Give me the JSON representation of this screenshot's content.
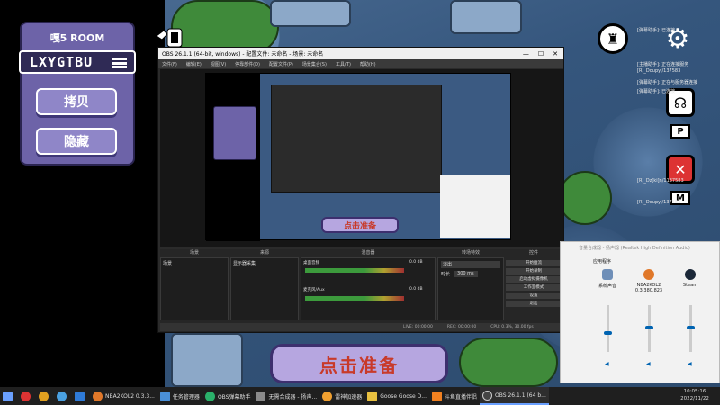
{
  "room_panel": {
    "title": "嘎5 ROOM",
    "code": "LXYGTBU",
    "copy_label": "拷贝",
    "hide_label": "隐藏"
  },
  "ready_button": {
    "label": "点击准备"
  },
  "obs": {
    "title": "OBS 26.1.1 (64-bit, windows) - 配置文件: 未命名 - 场景: 未命名",
    "menu": [
      "文件(F)",
      "编辑(E)",
      "视图(V)",
      "停靠部件(D)",
      "配置文件(P)",
      "场景集合(S)",
      "工具(T)",
      "帮助(H)"
    ],
    "docks": {
      "scenes_header": "场景",
      "sources_header": "来源",
      "mixer_header": "混音器",
      "transitions_header": "转场特效",
      "controls_header": "控件",
      "scene_item": "场景",
      "source_item": "显示器采集",
      "desktop_audio": "桌面音频",
      "mic_audio": "麦克风/Aux",
      "desktop_db": "0.0 dB",
      "mic_db": "0.0 dB",
      "transition": "淡出",
      "duration_label": "时长",
      "duration_value": "300 ms",
      "unselected_source": "未选择源"
    },
    "controls": [
      "开始推流",
      "开始录制",
      "启动虚拟摄像机",
      "工作室模式",
      "设置",
      "退出"
    ],
    "status": {
      "live": "LIVE: 00:00:00",
      "rec": "REC: 00:00:00",
      "cpu": "CPU: 0.3%, 30.00 fps"
    }
  },
  "volume_mixer": {
    "title": "音量合成器 - 扬声器 (Realtek High Definition Audio)",
    "section": "应用程序",
    "apps": [
      {
        "name": "系统声音",
        "level": 0.45
      },
      {
        "name": "NBA2KOL2 0.3.380.823",
        "level": 0.55
      },
      {
        "name": "Steam",
        "level": 0.55
      }
    ]
  },
  "hud": {
    "keys": [
      "P",
      "M"
    ],
    "log": [
      "[弹幕助手]: 已连接",
      "[主播助手]: 正在连接服务",
      "[R]_Doupyl/137583",
      "[弹幕助手]: 正在与服务器连接",
      "[弹幕助手]: 已连接",
      "[R]_Dz[ki]n/1137583",
      "[R]_Doupyl/137583"
    ]
  },
  "taskbar": {
    "items": [
      "NBA2KOL2 0.3.3...",
      "任务管理器",
      "OBS弹幕助手",
      "无需合成器 - 扬声...",
      "雷神加速器",
      "Goose Goose D...",
      "斗鱼直播伴侣",
      "OBS 26.1.1 (64 b..."
    ],
    "time": "10:05:16",
    "date": "2022/11/22"
  },
  "colors": {
    "accent_purple": "#6d63a8",
    "ready_red": "#c83a2a",
    "obs_bg": "#2b2b2b",
    "win_blue": "#0063b1"
  }
}
